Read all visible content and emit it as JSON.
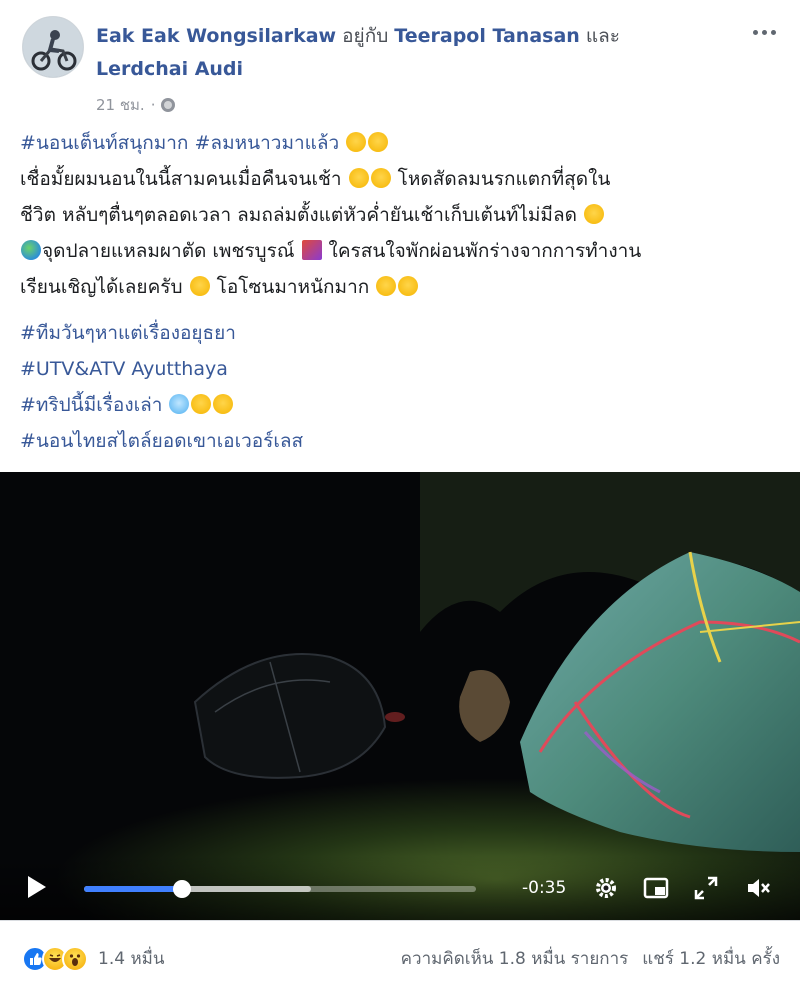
{
  "post": {
    "author": "Eak Eak Wongsilarkaw",
    "with_text": " อยู่กับ ",
    "tagged_1": "Teerapol Tanasan",
    "and_text": " และ ",
    "tagged_2": "Lerdchai Audi",
    "time": "21 ชม.",
    "separator": "·",
    "privacy_icon": "globe-icon"
  },
  "body": {
    "hashtag_1": "#นอนเต็นท์สนุกมาก",
    "hashtag_2": "#ลมหนาวมาแล้ว",
    "line_1": "เชื่อมั้ยผมนอนในนี้สามคนเมื่อคืนจนเช้า",
    "line_1b": "โหดสัดลมนรกแตกที่สุดใน",
    "line_2": "ชีวิต หลับๆตื่นๆตลอดเวลา ลมถล่มตั้งแต่หัวค่ำยันเช้าเก็บเต้นท์ไม่มีลด",
    "line_3a": "จุดปลายแหลมผาตัด เพชรบูรณ์",
    "line_3b": "ใครสนใจพักผ่อนพักร่างจากการทำงาน",
    "line_4a": "เรียนเชิญได้เลยครับ",
    "line_4b": "โอโซนมาหนักมาก",
    "tag_a": "#ทีมวันๆหาแต่เรื่องอยุธยา",
    "tag_b": "#UTV&ATV Ayutthaya",
    "tag_c": "#ทริปนี้มีเรื่องเล่า",
    "tag_d": "#นอนไทยสไตล์ยอดเขาเอเวอร์เลส"
  },
  "video": {
    "time_remaining": "-0:35",
    "progress": 0.25,
    "buffered": 0.58,
    "icons": [
      "play-icon",
      "settings-icon",
      "pip-icon",
      "fullscreen-icon",
      "mute-icon"
    ]
  },
  "footer": {
    "reaction_count": "1.4 หมื่น",
    "comments": "ความคิดเห็น 1.8 หมื่น รายการ",
    "shares": "แชร์ 1.2 หมื่น ครั้ง",
    "reactions": [
      "like",
      "haha",
      "wow"
    ]
  },
  "colors": {
    "link": "#385898",
    "accent": "#4080ff",
    "muted": "#90949c"
  }
}
